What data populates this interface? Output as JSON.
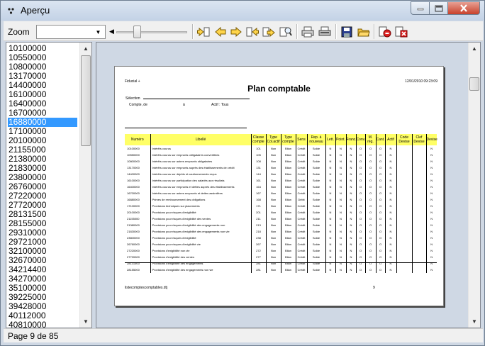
{
  "window": {
    "title": "Aperçu"
  },
  "toolbar": {
    "zoom_label": "Zoom",
    "zoom_value": "",
    "slider_level": 0.27,
    "buttons": [
      {
        "name": "first-page-icon"
      },
      {
        "name": "previous-page-icon"
      },
      {
        "name": "next-page-icon"
      },
      {
        "name": "last-page-icon"
      },
      {
        "name": "goto-page-icon"
      },
      {
        "name": "search-icon"
      },
      {
        "name": "print-icon"
      },
      {
        "name": "print-setup-icon"
      },
      {
        "name": "save-icon"
      },
      {
        "name": "open-folder-icon"
      },
      {
        "name": "stop-icon"
      },
      {
        "name": "close-preview-icon"
      }
    ]
  },
  "list": {
    "items": [
      "10100000",
      "10550000",
      "10800000",
      "13170000",
      "14400000",
      "16100000",
      "16400000",
      "16700000",
      "16880000",
      "17100000",
      "20100000",
      "21155000",
      "21380000",
      "21830000",
      "23800000",
      "26760000",
      "27220000",
      "27720000",
      "28131500",
      "28155000",
      "29310000",
      "29721000",
      "32100000",
      "32670000",
      "34214400",
      "34270000",
      "35100000",
      "39225000",
      "39428000",
      "40112000",
      "40810000"
    ],
    "selected_index": 8
  },
  "report": {
    "company": "Fiducial +",
    "datetime": "12/01/2010 09:23:09",
    "title": "Plan comptable",
    "selection_label": "Sélection",
    "filter_label": "Compte, de",
    "filter_range": "à",
    "filter_actif": "Actif : Tous",
    "columns": [
      "Numéro",
      "Libellé",
      "Classe compte",
      "Type Col.actif",
      "Type compte",
      "Sens",
      "Rep. à nouveau",
      "Lett.",
      "Point.",
      "Franc.",
      "Conv.",
      "M. rég.",
      "Cant.",
      "Actif",
      "Code Devise",
      "Clef Devise",
      "Devise"
    ],
    "rows": [
      [
        "10100000",
        "Intérêts courus",
        "101",
        "Non",
        "Bilan",
        "Crédit",
        "Solde",
        "N",
        "N",
        "N",
        "O",
        "O",
        "O",
        "N",
        "",
        "",
        "N"
      ],
      [
        "10550000",
        "Intérêts courus sur emprunts obligataires convertibles",
        "105",
        "Non",
        "Bilan",
        "Crédit",
        "Solde",
        "N",
        "N",
        "N",
        "O",
        "O",
        "O",
        "N",
        "",
        "",
        "N"
      ],
      [
        "10800000",
        "Intérêts courus sur autres emprunts obligataires",
        "108",
        "Non",
        "Bilan",
        "Crédit",
        "Solde",
        "N",
        "N",
        "N",
        "O",
        "O",
        "O",
        "N",
        "",
        "",
        "N"
      ],
      [
        "13170000",
        "Intérêts courus sur emprunts auprès des établissements de crédit",
        "131",
        "Non",
        "Bilan",
        "Crédit",
        "Solde",
        "N",
        "N",
        "N",
        "O",
        "O",
        "O",
        "N",
        "",
        "",
        "N"
      ],
      [
        "14400000",
        "Intérêts courus sur dépôts et cautionnements reçus",
        "144",
        "Non",
        "Bilan",
        "Crédit",
        "Solde",
        "N",
        "N",
        "N",
        "O",
        "O",
        "O",
        "N",
        "",
        "",
        "N"
      ],
      [
        "16100000",
        "Intérêts courus sur participation des salariés aux résultats",
        "161",
        "Non",
        "Bilan",
        "Crédit",
        "Solde",
        "N",
        "N",
        "N",
        "O",
        "O",
        "O",
        "N",
        "",
        "",
        "N"
      ],
      [
        "16400000",
        "Intérêts courus sur emprunts et dettes auprès des établissements",
        "164",
        "Non",
        "Bilan",
        "Crédit",
        "Solde",
        "N",
        "N",
        "N",
        "O",
        "O",
        "O",
        "N",
        "",
        "",
        "N"
      ],
      [
        "16700000",
        "Intérêts courus sur autres emprunts et dettes assimilées",
        "167",
        "Non",
        "Bilan",
        "Crédit",
        "Solde",
        "N",
        "N",
        "N",
        "O",
        "O",
        "O",
        "N",
        "",
        "",
        "N"
      ],
      [
        "16880000",
        "Primes de remboursement des obligations",
        "168",
        "Non",
        "Bilan",
        "Débit",
        "Solde",
        "N",
        "N",
        "N",
        "O",
        "O",
        "O",
        "N",
        "",
        "",
        "N"
      ],
      [
        "17100000",
        "Provisions techniques sur placements",
        "171",
        "Non",
        "Bilan",
        "Crédit",
        "Solde",
        "N",
        "N",
        "N",
        "O",
        "O",
        "O",
        "N",
        "",
        "",
        "N"
      ],
      [
        "20100000",
        "Provisions pour risques d'exigibilité",
        "201",
        "Non",
        "Bilan",
        "Crédit",
        "Solde",
        "N",
        "N",
        "N",
        "O",
        "O",
        "O",
        "N",
        "",
        "",
        "N"
      ],
      [
        "21155000",
        "Provisions pour risques d'exigibilité des ventes",
        "211",
        "Non",
        "Bilan",
        "Crédit",
        "Solde",
        "N",
        "N",
        "N",
        "O",
        "O",
        "O",
        "N",
        "",
        "",
        "N"
      ],
      [
        "21380000",
        "Provisions pour risques d'exigibilité des engagements non",
        "213",
        "Non",
        "Bilan",
        "Crédit",
        "Solde",
        "N",
        "N",
        "N",
        "O",
        "O",
        "O",
        "N",
        "",
        "",
        "N"
      ],
      [
        "21830000",
        "Provisions pour risques d'exigibilité des engagements non vie",
        "218",
        "Non",
        "Bilan",
        "Crédit",
        "Solde",
        "N",
        "N",
        "N",
        "O",
        "O",
        "O",
        "N",
        "",
        "",
        "N"
      ],
      [
        "23800000",
        "Provisions pour risques d'exigibilité",
        "238",
        "Non",
        "Bilan",
        "Crédit",
        "Solde",
        "N",
        "N",
        "N",
        "O",
        "O",
        "O",
        "N",
        "",
        "",
        "N"
      ],
      [
        "26760000",
        "Provisions pour risques d'exigibilité vie",
        "267",
        "Non",
        "Bilan",
        "Crédit",
        "Solde",
        "N",
        "N",
        "N",
        "O",
        "O",
        "O",
        "N",
        "",
        "",
        "N"
      ],
      [
        "27220000",
        "Provisions d'exigibilité non vie",
        "272",
        "Non",
        "Bilan",
        "Crédit",
        "Solde",
        "N",
        "N",
        "N",
        "O",
        "O",
        "O",
        "N",
        "",
        "",
        "N"
      ],
      [
        "27720000",
        "Provisions d'exigibilité des ventes",
        "277",
        "Non",
        "Bilan",
        "Crédit",
        "Solde",
        "N",
        "N",
        "N",
        "O",
        "O",
        "O",
        "N",
        "",
        "",
        "N"
      ],
      [
        "28131500",
        "Provisions d'exigibilité des engagements",
        "281",
        "Non",
        "Bilan",
        "Crédit",
        "Solde",
        "N",
        "N",
        "N",
        "O",
        "O",
        "O",
        "N",
        "",
        "",
        "N"
      ],
      [
        "28155000",
        "Provisions d'exigibilité des engagements non vie",
        "281",
        "Non",
        "Bilan",
        "Crédit",
        "Solde",
        "N",
        "N",
        "N",
        "O",
        "O",
        "O",
        "N",
        "",
        "",
        "N"
      ]
    ],
    "footer_file": "listecomptescomptables.dtj",
    "footer_page": "9"
  },
  "status": {
    "text": "Page 9 de 85"
  },
  "colors": {
    "selection": "#3399ff",
    "header_yellow": "#ffff66",
    "close_red": "#c8412b"
  }
}
